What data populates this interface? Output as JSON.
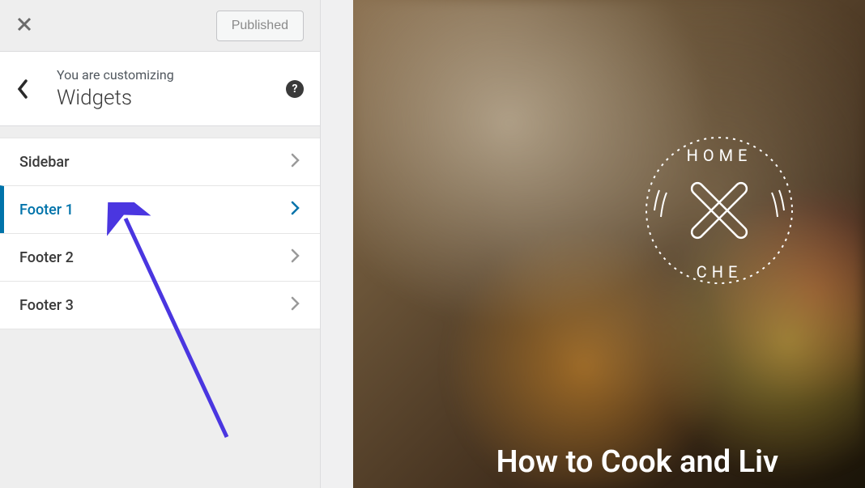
{
  "topbar": {
    "publish_label": "Published"
  },
  "header": {
    "customizing_label": "You are customizing",
    "title": "Widgets",
    "help_glyph": "?"
  },
  "widgets": {
    "items": [
      {
        "label": "Sidebar",
        "active": false
      },
      {
        "label": "Footer 1",
        "active": true
      },
      {
        "label": "Footer 2",
        "active": false
      },
      {
        "label": "Footer 3",
        "active": false
      }
    ]
  },
  "preview": {
    "logo_top_text": "HOME",
    "logo_bottom_text": "CHE",
    "hero_text": "How to Cook and Liv"
  },
  "colors": {
    "accent": "#0073aa",
    "annotation_arrow": "#4a36e0"
  }
}
